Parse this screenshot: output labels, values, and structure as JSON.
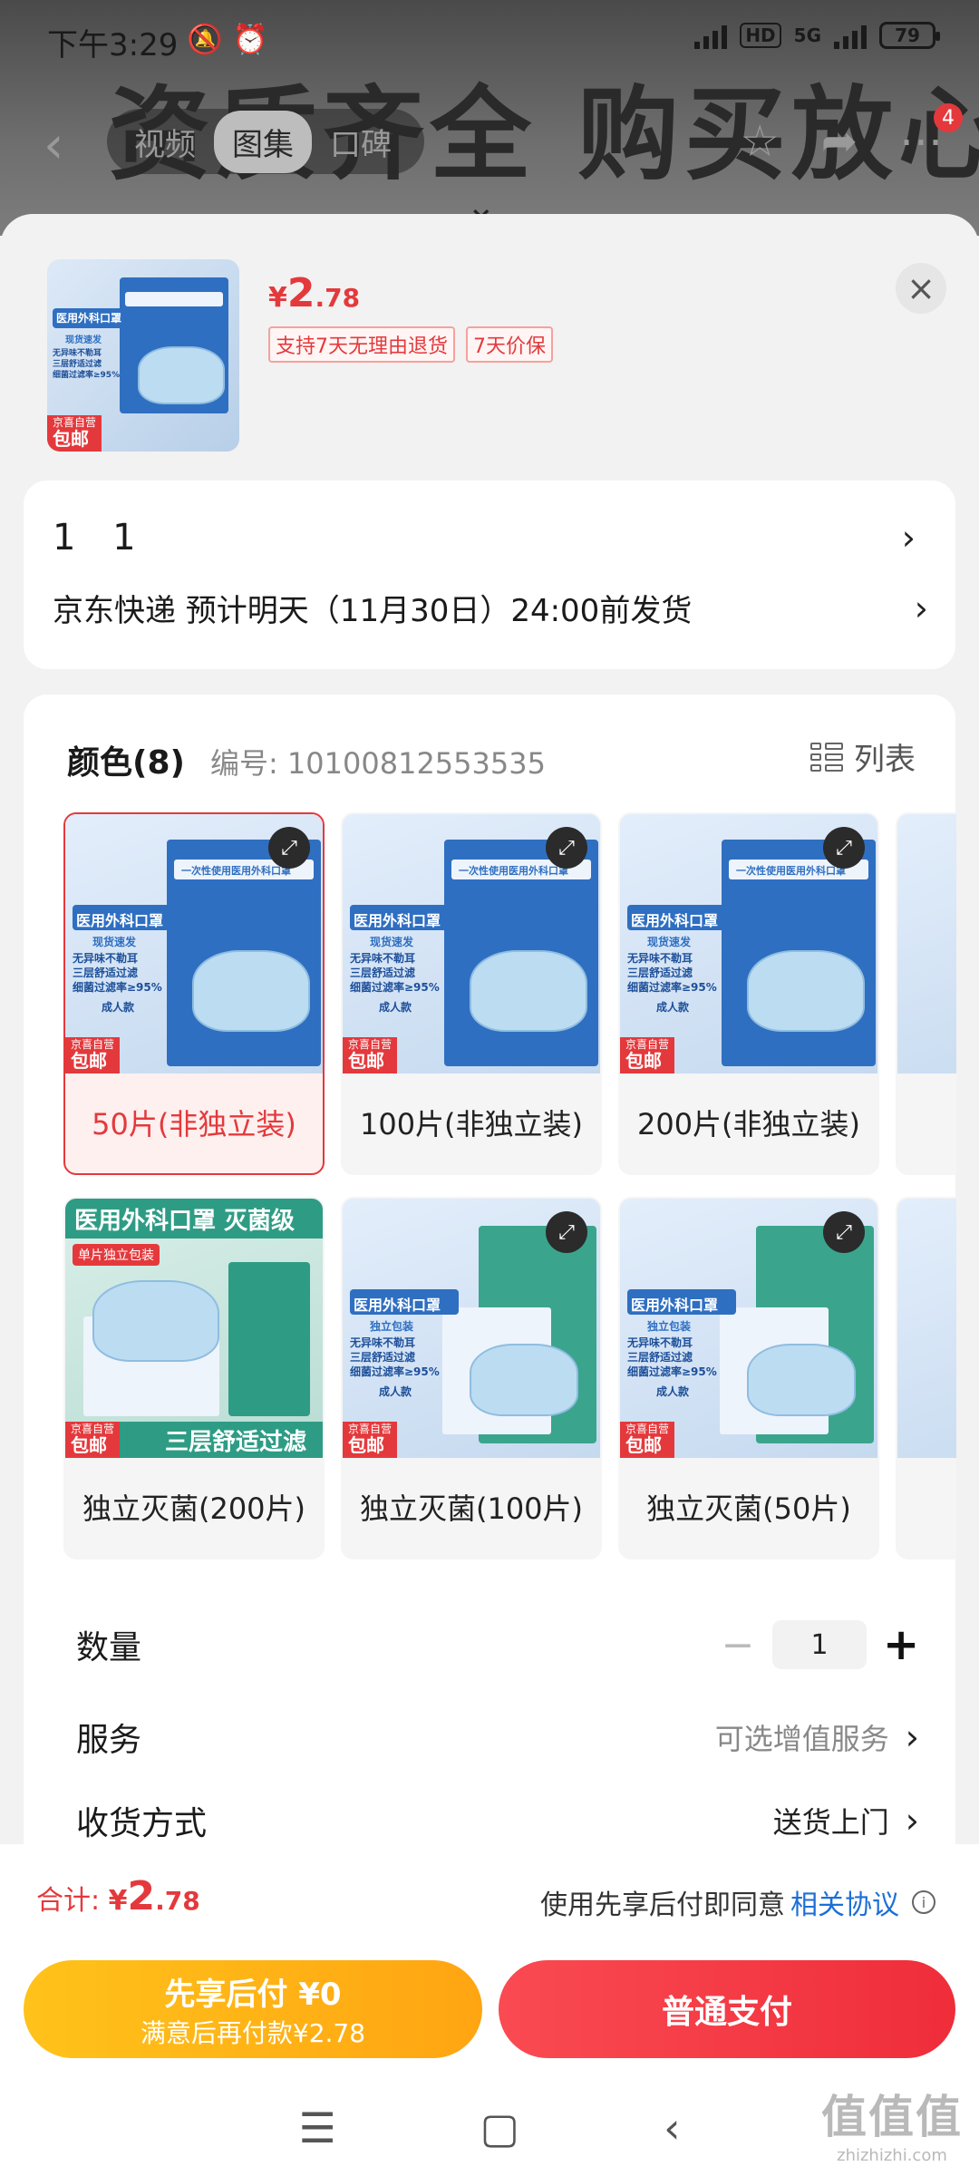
{
  "status": {
    "time": "下午3:29",
    "signal_label": "5G",
    "battery": "79"
  },
  "background": {
    "title": "资质齐全 购买放心",
    "tabs": [
      "视频",
      "图集",
      "口碑"
    ],
    "more_badge": "4"
  },
  "product": {
    "price_currency": "¥",
    "price_int": "2",
    "price_dec": ".78",
    "tags": [
      "支持7天无理由退货",
      "7天价保"
    ],
    "thumb": {
      "title": "医用外科口罩",
      "sub": "现货速发",
      "lines": [
        "无异味不勒耳",
        "三层舒适过滤",
        "细菌过滤率≥95%"
      ],
      "jd_small": "京喜自营",
      "jd_big": "包邮"
    }
  },
  "address": {
    "name": "1 1",
    "shipping": "京东快递 预计明天（11月30日）24:00前发货"
  },
  "spec": {
    "title": "颜色(8)",
    "code": "编号: 10100812553535",
    "list_label": "列表",
    "options": [
      {
        "label": "50片(非独立装)",
        "style": "blue"
      },
      {
        "label": "100片(非独立装)",
        "style": "blue"
      },
      {
        "label": "200片(非独立装)",
        "style": "blue"
      },
      {
        "label": "独立灭菌(200片)",
        "style": "green"
      },
      {
        "label": "独立灭菌(100片)",
        "style": "blue-green"
      },
      {
        "label": "独立灭菌(50片)",
        "style": "blue-green"
      }
    ],
    "green_banner": "医用外科口罩 灭菌级",
    "green_sub": "单片独立包装",
    "green_foot": "三层舒适过滤",
    "pack_title": "医用外科口罩",
    "pack_sub_a": "现货速发",
    "pack_sub_b": "独立包装",
    "pack_strip": "一次性使用医用外科口罩",
    "pack_lines": [
      "无异味不勒耳",
      "三层舒适过滤",
      "细菌过滤率≥95%"
    ],
    "adult": "成人款",
    "jd_small": "京喜自营",
    "jd_big": "包邮"
  },
  "rows": {
    "qty_label": "数量",
    "qty_value": "1",
    "service_label": "服务",
    "service_value": "可选增值服务",
    "delivery_label": "收货方式",
    "delivery_value": "送货上门"
  },
  "bottom": {
    "total_label": "合计: ",
    "total_currency": "¥",
    "total_int": "2",
    "total_dec": ".78",
    "agree_text": "使用先享后付即同意",
    "agree_link": "相关协议",
    "btn_later_l1": "先享后付 ¥0",
    "btn_later_l2": "满意后再付款¥2.78",
    "btn_pay": "普通支付"
  },
  "watermark": {
    "main": "值值值",
    "sub": "zhizhizhi.com"
  },
  "colors": {
    "accent_red": "#e4393c",
    "link_blue": "#1d6fd6",
    "yellow_button": "#ffb318"
  }
}
